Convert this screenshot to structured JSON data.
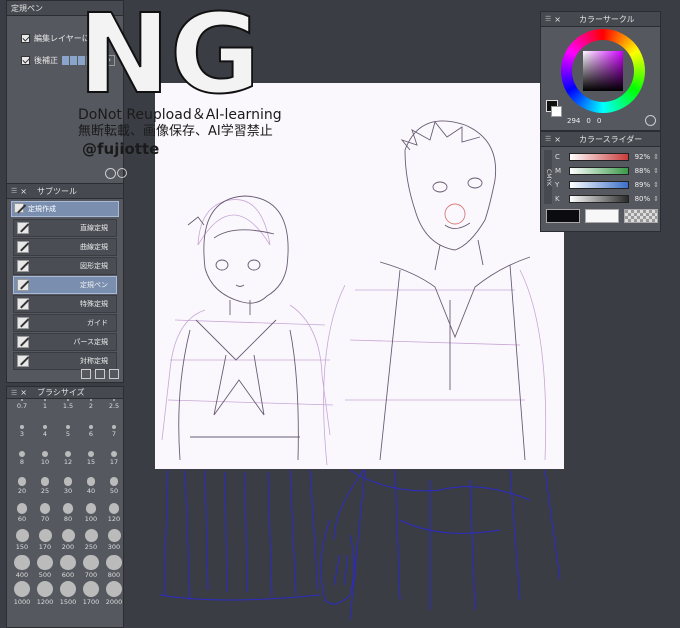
{
  "watermark": {
    "logo": "NG",
    "line1": "DoNot Reupload＆AI-learning",
    "line2": "無断転載、画像保存、AI学習禁止",
    "handle": "@fujiotte"
  },
  "tool_property": {
    "title": "定規ペン",
    "edit_layer_label": "編集レイヤーに作成",
    "correction_label": "後補正"
  },
  "subtool": {
    "title": "サブツール",
    "group": "定規作成",
    "items": [
      {
        "label": "直線定規",
        "selected": false
      },
      {
        "label": "曲線定規",
        "selected": false
      },
      {
        "label": "図形定規",
        "selected": false
      },
      {
        "label": "定規ペン",
        "selected": true
      },
      {
        "label": "特殊定規",
        "selected": false
      },
      {
        "label": "ガイド",
        "selected": false
      },
      {
        "label": "パース定規",
        "selected": false
      },
      {
        "label": "対称定規",
        "selected": false
      }
    ]
  },
  "brush_size": {
    "title": "ブラシサイズ",
    "sizes": [
      "0.7",
      "1",
      "1.5",
      "2",
      "2.5",
      "3",
      "4",
      "5",
      "6",
      "7",
      "8",
      "10",
      "12",
      "15",
      "17",
      "20",
      "25",
      "30",
      "40",
      "50",
      "60",
      "70",
      "80",
      "100",
      "120",
      "150",
      "170",
      "200",
      "250",
      "300",
      "400",
      "500",
      "600",
      "700",
      "800",
      "1000",
      "1200",
      "1500",
      "1700",
      "2000"
    ]
  },
  "color_circle": {
    "title": "カラーサークル",
    "hue_value": "294",
    "s_value": "0",
    "v_value": "0"
  },
  "color_slider": {
    "title": "カラースライダー",
    "mode_label": "CMYK",
    "channels": [
      {
        "name": "C",
        "value": "92%",
        "color": "#c93b3b"
      },
      {
        "name": "M",
        "value": "88%",
        "color": "#3b9a4a"
      },
      {
        "name": "Y",
        "value": "89%",
        "color": "#3a6fc7"
      },
      {
        "name": "K",
        "value": "80%",
        "color": "#2a2a2a"
      }
    ]
  },
  "colors": {
    "panel_bg": "#55585f",
    "workspace_bg": "#3a3d44",
    "canvas_bg": "#fbf8fd",
    "selection": "#7a8fb0",
    "sketch_purple": "#c7a6d6",
    "sketch_blue": "#2c2ac4"
  },
  "icons": [
    "close-icon",
    "grip-icon",
    "checkbox-icon",
    "ruler-pen-icon",
    "rotate-icon",
    "zoom-icon",
    "add-icon",
    "duplicate-icon",
    "trash-icon",
    "settings-icon"
  ]
}
